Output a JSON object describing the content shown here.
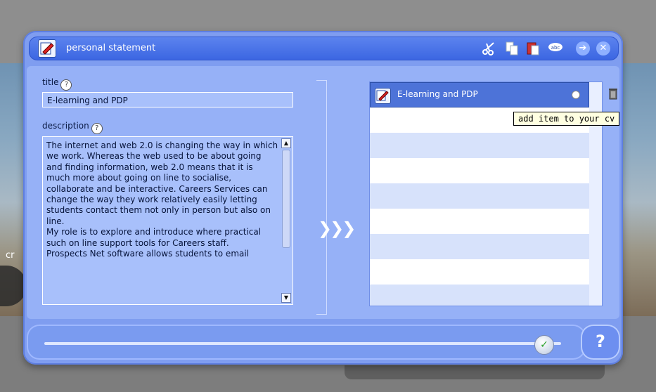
{
  "window": {
    "title": "personal statement"
  },
  "toolbar": {
    "cut_icon": "scissors-icon",
    "copy_icon": "copy-icon",
    "paste_icon": "paste-icon",
    "spell_icon": "abc-spellcheck-icon",
    "forward_glyph": "➔",
    "close_glyph": "✕",
    "spell_label": "abc"
  },
  "form": {
    "title_label": "title",
    "title_value": "E-learning and PDP",
    "description_label": "description",
    "description_value": "The internet and web 2.0 is changing the way in which we work. Whereas the web used to be about going and finding information, web 2.0 means that it is much more about going on line to socialise, collaborate and be interactive. Careers Services can change the way they work relatively easily letting students contact them not only in person but also on line.\nMy role is to explore and introduce where practical such on line support tools for Careers staff.\nProspects Net software allows students to email"
  },
  "transfer": {
    "add_arrows": "❯❯❯",
    "undo_glyph": "↰"
  },
  "cv_list": {
    "items": [
      {
        "label": "E-learning and PDP",
        "selected": true
      }
    ],
    "tooltip": "add item to your cv"
  },
  "background": {
    "partial_text": "cr"
  },
  "footer": {
    "slider_position_pct": 96,
    "knob_glyph": "✓",
    "help_label": "?"
  }
}
